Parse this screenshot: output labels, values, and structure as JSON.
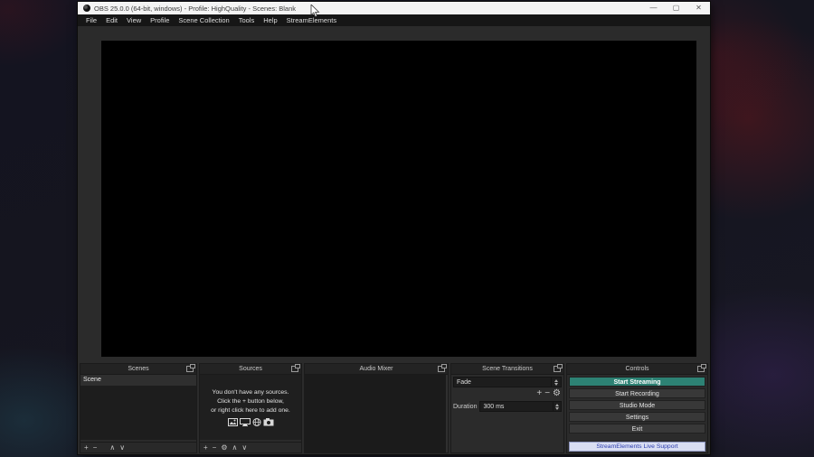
{
  "titlebar": {
    "title": "OBS 25.0.0 (64-bit, windows) - Profile: HighQuality - Scenes: Blank",
    "minimize": "—",
    "maximize": "▢",
    "close": "✕"
  },
  "menu": {
    "file": "File",
    "edit": "Edit",
    "view": "View",
    "profile": "Profile",
    "scene_collection": "Scene Collection",
    "tools": "Tools",
    "help": "Help",
    "streamelements": "StreamElements"
  },
  "docks": {
    "scenes": {
      "title": "Scenes",
      "scene_item": "Scene",
      "add": "+",
      "remove": "−",
      "up": "∧",
      "down": "∨"
    },
    "sources": {
      "title": "Sources",
      "empty_line1": "You don't have any sources.",
      "empty_line2": "Click the + button below,",
      "empty_line3": "or right click here to add one.",
      "add": "+",
      "remove": "−",
      "gear": "⚙",
      "up": "∧",
      "down": "∨"
    },
    "audio_mixer": {
      "title": "Audio Mixer"
    },
    "transitions": {
      "title": "Scene Transitions",
      "selected": "Fade",
      "add": "+",
      "remove": "−",
      "gear": "⚙",
      "duration_label": "Duration",
      "duration_value": "300 ms"
    },
    "controls": {
      "title": "Controls",
      "start_streaming": "Start Streaming",
      "start_recording": "Start Recording",
      "studio_mode": "Studio Mode",
      "settings": "Settings",
      "exit": "Exit",
      "support": "StreamElements Live Support"
    }
  },
  "colors": {
    "accent_teal": "#2d8274",
    "support_bg": "#d9def2",
    "support_text": "#2b3cae"
  }
}
